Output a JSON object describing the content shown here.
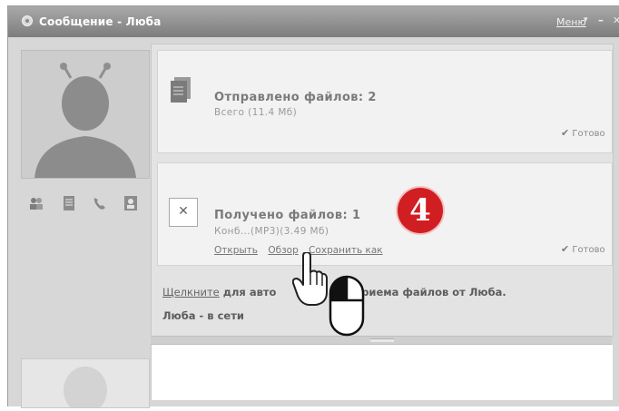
{
  "window": {
    "title": "Сообщение - Люба",
    "menu_label": "Меню",
    "menu_arrow": "▾",
    "minimize_glyph": "–",
    "close_glyph": "✕"
  },
  "sent_panel": {
    "title": "Отправлено файлов: 2",
    "subtitle": "Всего  (11.4 Мб)",
    "status_check": "✔",
    "status": "Готово"
  },
  "received_panel": {
    "title": "Получено файлов: 1",
    "subtitle": "Конб...(MP3)(3.49 Мб)",
    "file_glyph": "✕",
    "actions": {
      "open": "Открыть",
      "browse": "Обзор",
      "save_as": "Сохранить как"
    },
    "status_check": "✔",
    "status": "Готово"
  },
  "messages": {
    "auto_receive_link": "Щелкните",
    "auto_receive_text_a": " для авто",
    "auto_receive_text_b": "ого приема файлов от Люба.",
    "presence": "Люба - в сети"
  },
  "overlay": {
    "step_number": "4",
    "step_color": "#d01e22"
  },
  "icons": {
    "title": "messenger-icon",
    "side": [
      "contacts-icon",
      "notes-icon",
      "phone-icon",
      "profile-icon"
    ],
    "sent_file": "document-icon",
    "received_file": "missing-file-icon",
    "pointer": "hand-cursor-icon",
    "click_hint": "mouse-left-click-icon"
  }
}
